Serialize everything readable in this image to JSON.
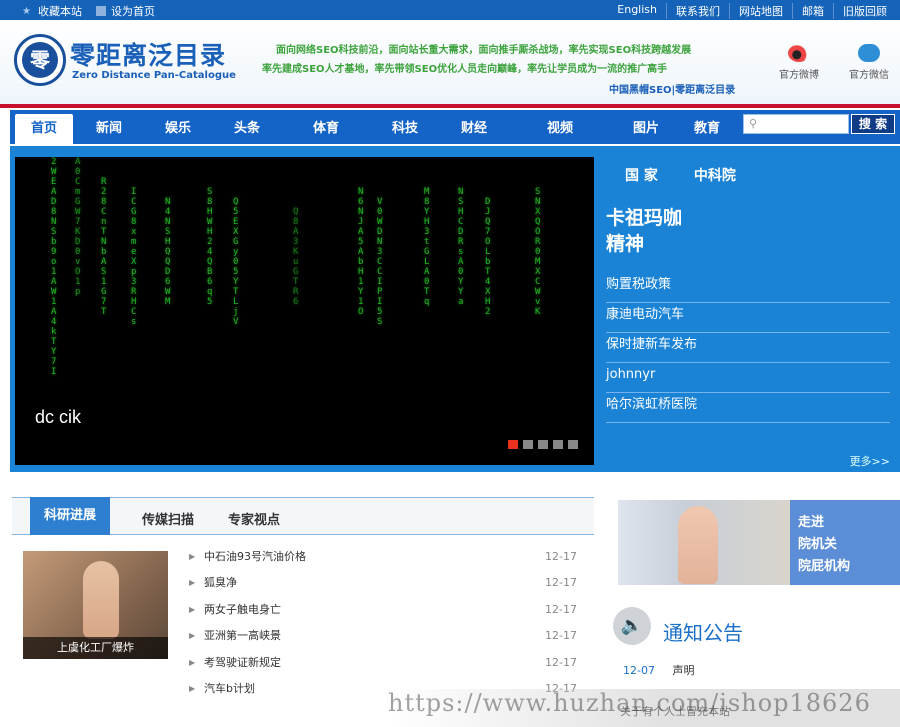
{
  "topbar": {
    "left": [
      {
        "icon": "star-icon",
        "label": "收藏本站"
      },
      {
        "icon": "home-icon",
        "label": "设为首页"
      }
    ],
    "right": [
      "English",
      "联系我们",
      "网站地图",
      "邮箱",
      "旧版回顾"
    ]
  },
  "header": {
    "logo_mark": "零",
    "logo_title": "零距离泛目录",
    "logo_subtitle": "Zero Distance Pan-Catalogue",
    "slogan_line1": "面向网络SEO科技前沿，面向站长重大需求，面向推手厮杀战场，率先实现SEO科技跨越发展",
    "slogan_line2": "率先建成SEO人才基地，率先带领SEO优化人员走向巅峰，率先让学员成为一流的推广高手",
    "slogan_line3": "中国黑帽SEO|零距离泛目录",
    "social": [
      {
        "icon": "weibo-icon",
        "label": "官方微博"
      },
      {
        "icon": "wechat-icon",
        "label": "官方微信"
      }
    ]
  },
  "nav": {
    "tabs": [
      "首页",
      "新闻",
      "娱乐",
      "头条",
      "体育",
      "科技",
      "财经",
      "视频",
      "图片",
      "教育"
    ],
    "active": "首页",
    "search_placeholder": "",
    "search_button": "搜 索"
  },
  "hero": {
    "caption": "dc cik",
    "slide_count": 5,
    "active_slide": 1,
    "side_tabs": [
      "国 家",
      "中科院"
    ],
    "headline_line1": "卡祖玛咖",
    "headline_line2": "精神",
    "links": [
      "购置税政策",
      "康迪电动汽车",
      "保时捷新车发布",
      "johnnyr",
      "哈尔滨虹桥医院"
    ],
    "more": "更多>>"
  },
  "news": {
    "tabs": [
      "科研进展",
      "传媒扫描",
      "专家视点"
    ],
    "active_tab": "科研进展",
    "image_caption": "上虞化工厂爆炸",
    "items": [
      {
        "title": "中石油93号汽油价格",
        "date": "12-17"
      },
      {
        "title": "狐臭净",
        "date": "12-17"
      },
      {
        "title": "两女子触电身亡",
        "date": "12-17"
      },
      {
        "title": "亚洲第一高峡景",
        "date": "12-17"
      },
      {
        "title": "考驾驶证新规定",
        "date": "12-17"
      },
      {
        "title": "汽车b计划",
        "date": "12-17"
      }
    ]
  },
  "feature": {
    "lines": [
      "走进",
      "院机关",
      "院屁机构"
    ]
  },
  "notice": {
    "title": "通知公告",
    "icon": "speaker-icon",
    "items": [
      {
        "date": "12-07",
        "title": "声明"
      }
    ]
  },
  "watermark": {
    "url": "https://www.huzhan.com/ishop18626",
    "overlay": "关于有个人士冒充本站"
  },
  "colors": {
    "topbar": "#1463b8",
    "nav": "#1463c7",
    "hero": "#1a83d6",
    "accent_red": "#c8102e",
    "slogan_green": "#3da33d"
  }
}
